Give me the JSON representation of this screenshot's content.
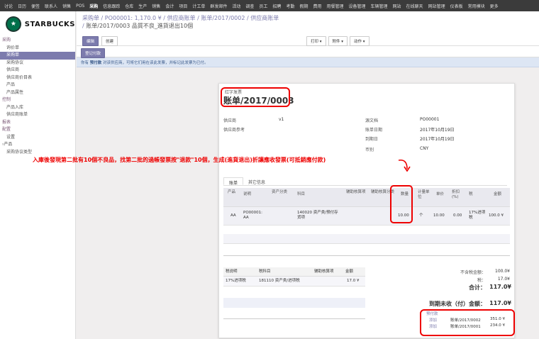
{
  "topnav": [
    "讨论",
    "日历",
    "便签",
    "联系人",
    "销售",
    "POS",
    "采购",
    "信息跟踪",
    "仓库",
    "生产",
    "销售",
    "会计",
    "项目",
    "计工单",
    "群发邮件",
    "活动",
    "调查",
    "员工",
    "招聘",
    "考勤",
    "假期",
    "费用",
    "用餐管理",
    "设备管理",
    "车辆管理",
    "网站",
    "在线聊天",
    "网站管理",
    "仪表板",
    "常用模块",
    "更多"
  ],
  "topnav_active_index": 6,
  "logo": {
    "text": "STARBUCKS",
    "mark": "★"
  },
  "sidebar": [
    {
      "label": "采购",
      "type": "sec"
    },
    {
      "label": "询价单",
      "type": "item"
    },
    {
      "label": "采购单",
      "type": "item",
      "active": true
    },
    {
      "label": "采购协议",
      "type": "item"
    },
    {
      "label": "供应商",
      "type": "item"
    },
    {
      "label": "供应商价目表",
      "type": "item"
    },
    {
      "label": "产品",
      "type": "item"
    },
    {
      "label": "产品属性",
      "type": "item"
    },
    {
      "label": "控制",
      "type": "sec"
    },
    {
      "label": "产品入库",
      "type": "item"
    },
    {
      "label": "供应商账单",
      "type": "item"
    },
    {
      "label": "报表",
      "type": "sec"
    },
    {
      "label": "配置",
      "type": "sec"
    },
    {
      "label": "设置",
      "type": "item"
    },
    {
      "label": "›产品",
      "type": "sub"
    },
    {
      "label": "采购协议类型",
      "type": "item"
    }
  ],
  "breadcrumb": {
    "line1": [
      "采购单",
      "PO00001: 1,170.0 ¥",
      "供应商账单",
      "账单/2017/0002",
      "供应商账单"
    ],
    "line2_current": "账单/2017/0003 品質不良_進貨退出10個"
  },
  "buttons": {
    "edit": "编辑",
    "create": "创建",
    "print": "打印 ▾",
    "attach": "附件 ▾",
    "action": "动作 ▾"
  },
  "status_button": "登记付款",
  "alert": {
    "prefix": "你有",
    "bold": "预付款",
    "rest": "对该供应商，可将它们用在该此发票，并标记此发票为已付。"
  },
  "document": {
    "draft_label": "红字发票",
    "title": "账单/2017/0003",
    "vendor_label": "供应商",
    "vendor_value": "v1",
    "vendor_ref_label": "供应商参考",
    "source_label": "源文档",
    "source_value": "PO00001",
    "bill_date_label": "账单日期",
    "bill_date_value": "2017年10月19日",
    "due_date_label": "到期日",
    "due_date_value": "2017年10月19日",
    "currency_label": "币别",
    "currency_value": "CNY"
  },
  "annotation": "入庫後發現第二批有10個不良品，找第二批的過帳發票按\"退款\"10個，生成(進貨退出)折讓應收發票(可抵銷應付款)",
  "tabs": [
    "账单",
    "其它信息"
  ],
  "lines": {
    "headers": [
      "产品",
      "说明",
      "资产分类",
      "科目",
      "辅助核算项",
      "辅助核算分类",
      "数量",
      "计量单位",
      "单价",
      "折扣(%)",
      "税",
      "金额"
    ],
    "rows": [
      {
        "product": "AA",
        "desc": "PO00001: AA",
        "asset": "",
        "account": "140020 资产类/预付存货项",
        "analytic": "",
        "analytic_tag": "",
        "qty": "10.00",
        "uom": "个",
        "price": "10.00",
        "discount": "0.00",
        "tax": "17%进项税",
        "amount": "100.0 ¥"
      }
    ]
  },
  "taxes": {
    "headers": [
      "税说明",
      "税科目",
      "辅助核算项",
      "金额"
    ],
    "rows": [
      {
        "desc": "17%进项税",
        "account": "181110 资产类/进项税",
        "analytic": "",
        "amount": "17.0 ¥"
      }
    ]
  },
  "totals": {
    "untaxed_label": "不含税金额：",
    "untaxed_value": "100.0¥",
    "tax_label": "税：",
    "tax_value": "17.0¥",
    "total_label": "合计：",
    "total_value": "117.0¥",
    "due_label": "到期未收（付）金额：",
    "due_value": "117.0¥"
  },
  "prepayments": {
    "title": "预付款",
    "rows": [
      {
        "action": "添加",
        "ref": "账单/2017/0002",
        "amount": "351.0 ¥"
      },
      {
        "action": "添加",
        "ref": "账单/2017/0001",
        "amount": "234.0 ¥"
      }
    ]
  },
  "colors": {
    "accent": "#7c7bad",
    "highlight": "#ee0000",
    "topbar": "#3b3b3b"
  }
}
